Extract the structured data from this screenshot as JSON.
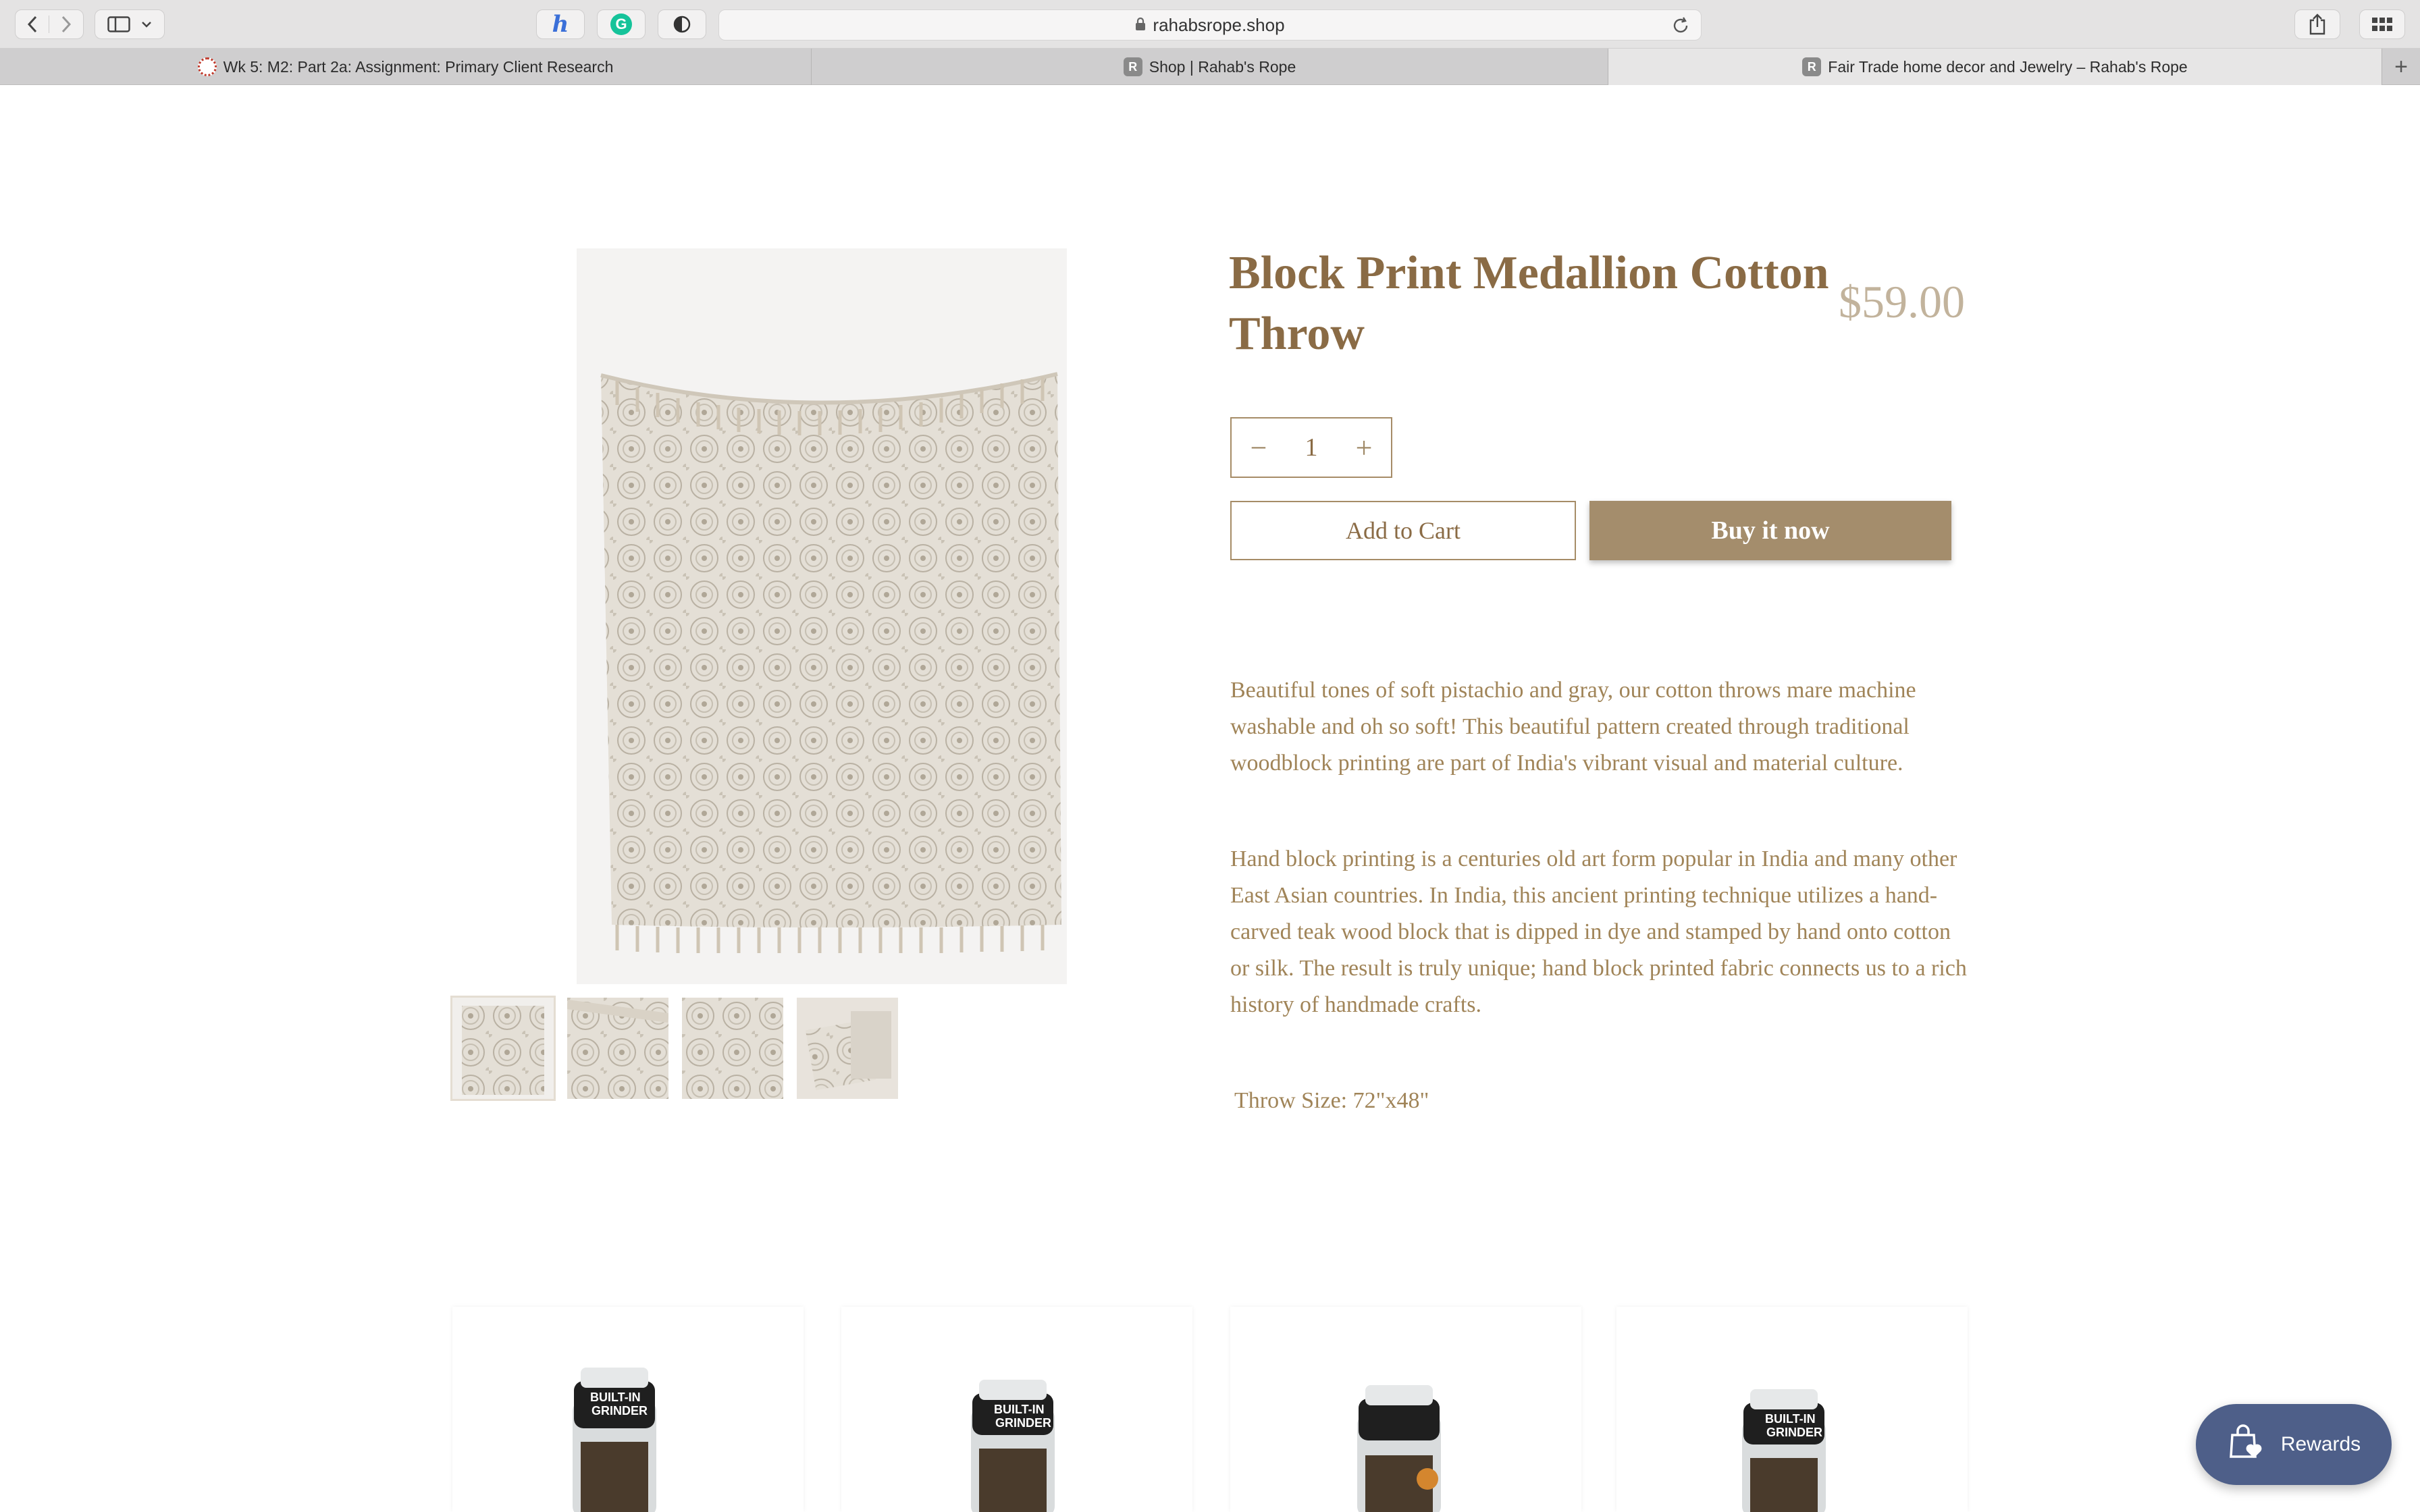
{
  "browser": {
    "url": "rahabsrope.shop",
    "tabs": [
      {
        "label": "Wk 5: M2: Part 2a: Assignment: Primary Client Research",
        "favicon": "canvas-logo-icon"
      },
      {
        "label": "Shop | Rahab's Rope",
        "favicon": "R"
      },
      {
        "label": "Fair Trade home decor and Jewelry – Rahab's Rope",
        "favicon": "R"
      }
    ],
    "new_tab": "+"
  },
  "product": {
    "title": "Block Print Medallion Cotton Throw",
    "price": "$59.00",
    "quantity": "1",
    "minus": "−",
    "plus": "+",
    "add_to_cart": "Add to Cart",
    "buy_now": "Buy it now",
    "description": [
      "Beautiful tones of soft pistachio and gray, our cotton throws mare machine washable and oh so soft! This beautiful pattern created through traditional woodblock printing are part of India's vibrant visual and material culture.",
      "Hand block printing is a centuries old art form popular in India and many other East Asian countries. In India, this ancient printing technique utilizes a hand-carved teak wood block that is dipped in dye and stamped by hand onto cotton or silk. The result is truly unique; hand block printed fabric connects us to a rich history of handmade crafts.",
      "Throw Size: 72\"x48\""
    ],
    "thumbnails": [
      "throw-full",
      "throw-fringe",
      "throw-pattern",
      "throw-pillow"
    ]
  },
  "related": {
    "grinder_label_1": "BUILT-IN",
    "grinder_label_2": "GRINDER"
  },
  "rewards": {
    "label": "Rewards"
  },
  "colors": {
    "accent": "#a48d6c",
    "text": "#8a6b45",
    "rewards": "#4e5f89"
  }
}
